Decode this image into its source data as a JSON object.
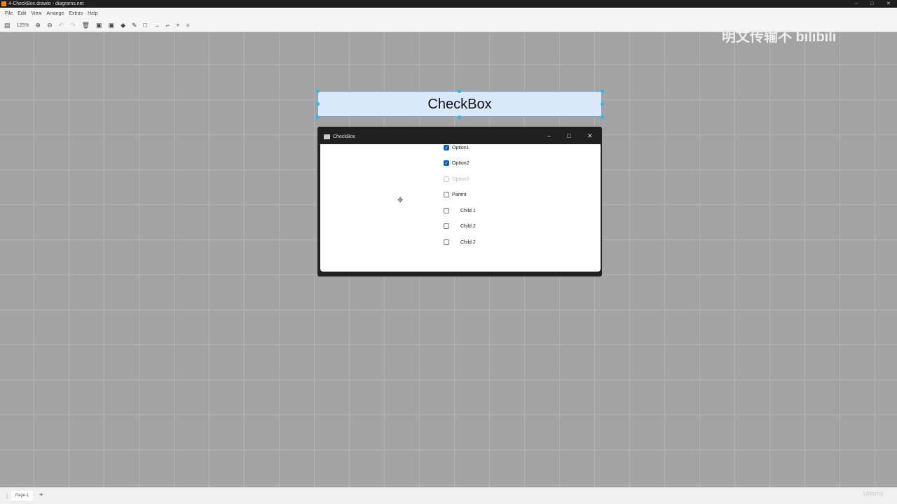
{
  "window": {
    "title": "4-CheckBox.drawio - diagrams.net"
  },
  "menu": [
    "File",
    "Edit",
    "View",
    "Arrange",
    "Extras",
    "Help"
  ],
  "toolbar": {
    "zoom": "125%"
  },
  "diagram": {
    "label": "CheckBox",
    "app_window": {
      "title": "CheckBox",
      "checkboxes": [
        {
          "label": "Option1",
          "checked": true,
          "disabled": false
        },
        {
          "label": "Option2",
          "checked": true,
          "disabled": false
        },
        {
          "label": "Option3",
          "checked": false,
          "disabled": true
        },
        {
          "label": "Parent",
          "checked": false,
          "disabled": false
        },
        {
          "label": "Child 1",
          "checked": false,
          "disabled": false
        },
        {
          "label": "Child 2",
          "checked": false,
          "disabled": false
        },
        {
          "label": "Child 2",
          "checked": false,
          "disabled": false
        }
      ]
    }
  },
  "pages": {
    "current": "Page-1"
  },
  "watermark": {
    "text": "明文传输不 bilibili",
    "udemy": "Udemy"
  }
}
